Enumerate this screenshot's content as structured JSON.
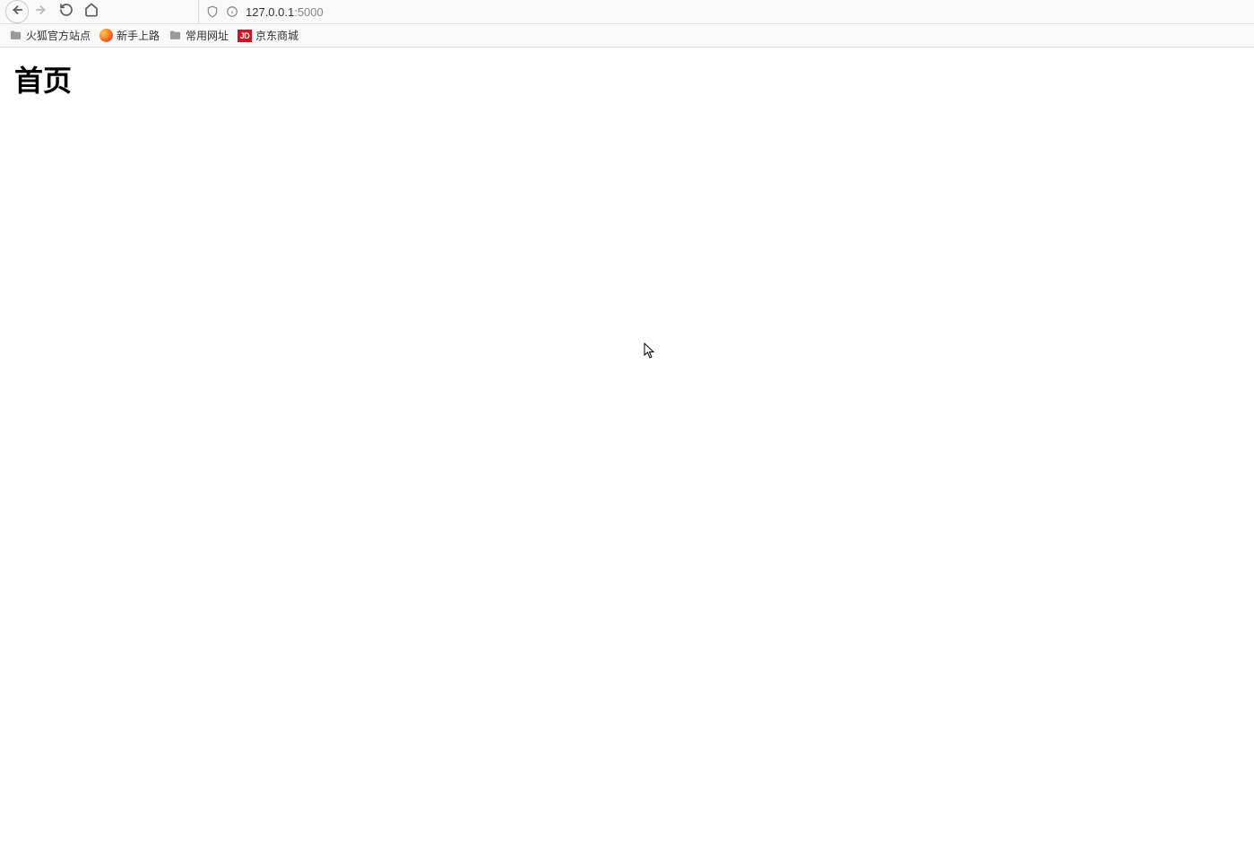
{
  "browser": {
    "url_host": "127.0.0.1",
    "url_port": ":5000"
  },
  "bookmarks": [
    {
      "label": "火狐官方站点",
      "icon": "folder"
    },
    {
      "label": "新手上路",
      "icon": "firefox"
    },
    {
      "label": "常用网址",
      "icon": "folder"
    },
    {
      "label": "京东商城",
      "icon": "jd",
      "badge": "JD"
    }
  ],
  "page": {
    "title": "首页"
  }
}
